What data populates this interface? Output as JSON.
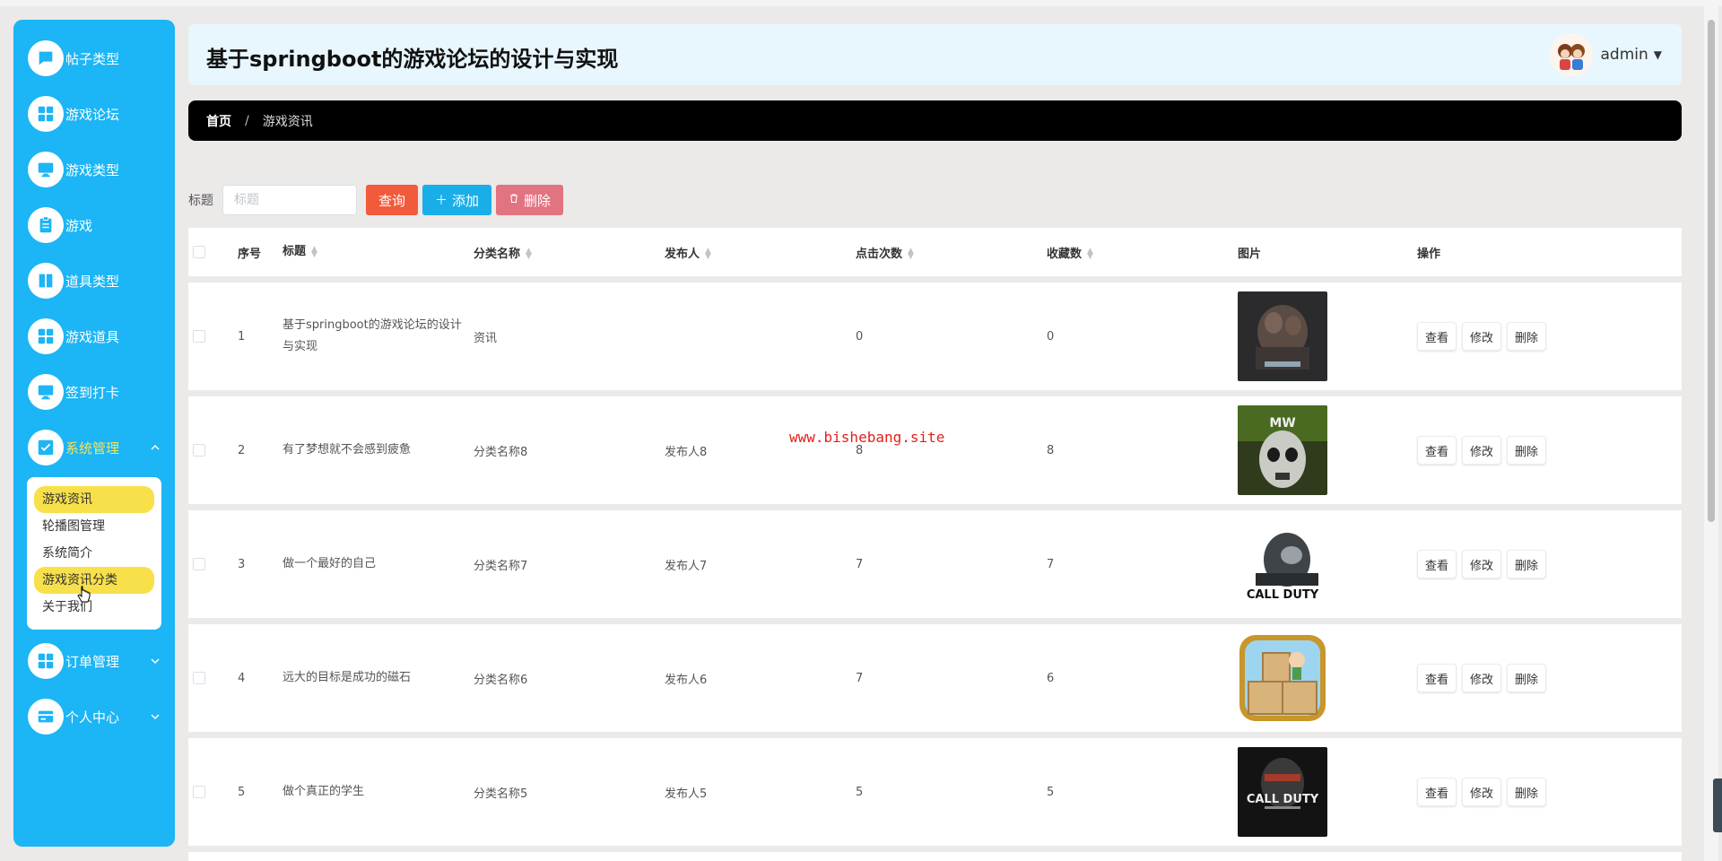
{
  "app": {
    "title": "基于springboot的游戏论坛的设计与实现",
    "user": "admin"
  },
  "sidebar": {
    "items": [
      {
        "label": "帖子类型",
        "icon": "chat-icon"
      },
      {
        "label": "游戏论坛",
        "icon": "grid-icon"
      },
      {
        "label": "游戏类型",
        "icon": "monitor-icon"
      },
      {
        "label": "游戏",
        "icon": "clipboard-icon"
      },
      {
        "label": "道具类型",
        "icon": "book-icon"
      },
      {
        "label": "游戏道具",
        "icon": "grid-icon"
      },
      {
        "label": "签到打卡",
        "icon": "monitor-icon"
      },
      {
        "label": "系统管理",
        "icon": "check-square-icon"
      },
      {
        "label": "订单管理",
        "icon": "grid-icon"
      },
      {
        "label": "个人中心",
        "icon": "card-icon"
      }
    ],
    "submenu": [
      "游戏资讯",
      "轮播图管理",
      "系统简介",
      "游戏资讯分类",
      "关于我们"
    ]
  },
  "breadcrumb": {
    "home": "首页",
    "separator": "/",
    "current": "游戏资讯"
  },
  "search": {
    "label": "标题",
    "placeholder": "标题",
    "query_btn": "查询",
    "add_btn": "添加",
    "delete_btn": "删除"
  },
  "table": {
    "headers": {
      "index": "序号",
      "title": "标题",
      "category": "分类名称",
      "publisher": "发布人",
      "clicks": "点击次数",
      "favorites": "收藏数",
      "image": "图片",
      "actions": "操作"
    },
    "row_actions": {
      "view": "查看",
      "edit": "修改",
      "delete": "删除"
    },
    "rows": [
      {
        "index": "1",
        "title": "基于springboot的游戏论坛的设计与实现",
        "category": "资讯",
        "publisher": "",
        "clicks": "0",
        "favorites": "0",
        "image": "warcraft-cover"
      },
      {
        "index": "2",
        "title": "有了梦想就不会感到疲惫",
        "category": "分类名称8",
        "publisher": "发布人8",
        "clicks": "8",
        "favorites": "8",
        "image": "mw2-skull-cover"
      },
      {
        "index": "3",
        "title": "做一个最好的自己",
        "category": "分类名称7",
        "publisher": "发布人7",
        "clicks": "7",
        "favorites": "7",
        "image": "call-of-duty-ghost-cover"
      },
      {
        "index": "4",
        "title": "远大的目标是成功的磁石",
        "category": "分类名称6",
        "publisher": "发布人6",
        "clicks": "7",
        "favorites": "6",
        "image": "crate-game-icon"
      },
      {
        "index": "5",
        "title": "做个真正的学生",
        "category": "分类名称5",
        "publisher": "发布人5",
        "clicks": "5",
        "favorites": "5",
        "image": "black-ops-cover"
      }
    ]
  },
  "watermark": "www.bishebang.site",
  "colors": {
    "sidebar": "#1cb5f5",
    "highlight": "#f8e04a",
    "query": "#f15a3a",
    "add": "#1aaee8",
    "delete": "#e27381"
  }
}
